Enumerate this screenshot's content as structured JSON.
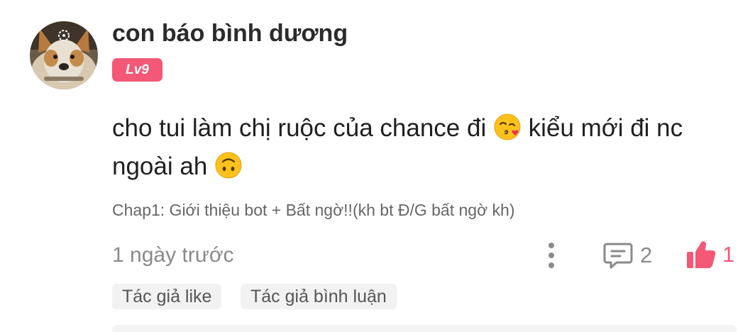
{
  "comment": {
    "username": "con báo bình dương",
    "level": "Lv9",
    "text_part1": "cho tui làm chị ruộc của chance đi ",
    "text_part2": " kiểu mới đi nc ngoài ah ",
    "chapter": "Chap1: Giới thiệu bot + Bất ngờ!!(kh bt Đ/G bất ngờ kh)",
    "timestamp": "1 ngày trước",
    "reply_count": "2",
    "like_count": "1",
    "tags": [
      "Tác giả like",
      "Tác giả bình luận"
    ]
  },
  "icons": {
    "more": "more-vertical-icon",
    "reply": "comment-icon",
    "like": "thumbs-up-icon",
    "emoji_1": "face-blowing-kiss-emoji",
    "emoji_2": "upside-down-face-emoji"
  },
  "colors": {
    "accent": "#f35876",
    "muted": "#8a8a8a",
    "tag_bg": "#f2f2f2"
  }
}
